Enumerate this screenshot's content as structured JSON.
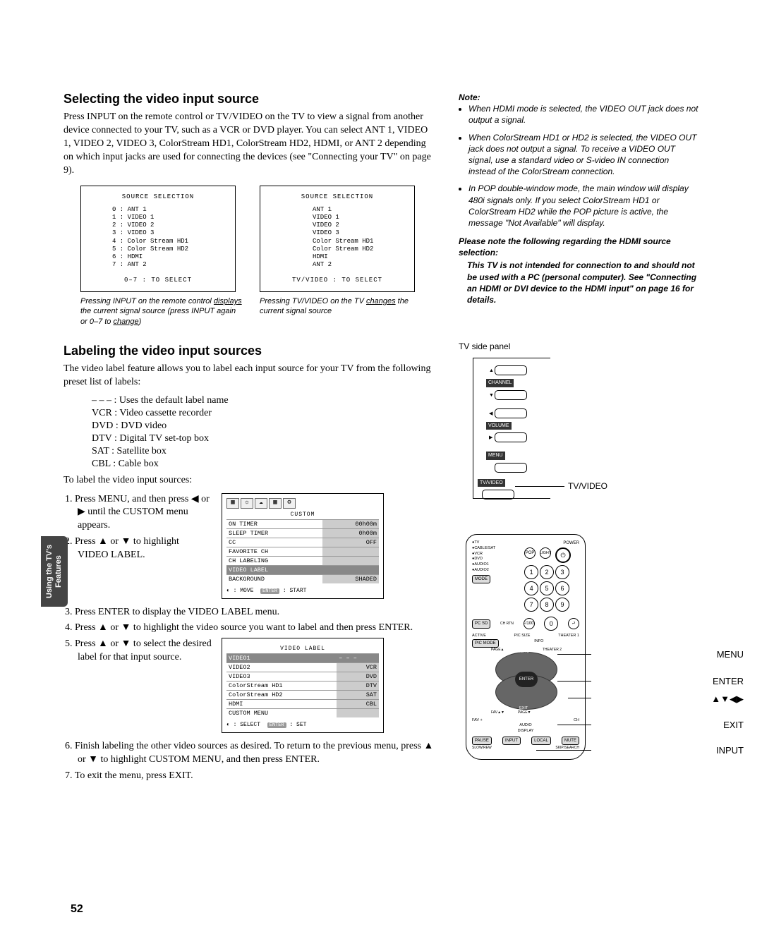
{
  "sidetab": "Using the TV's Features",
  "section1": {
    "heading": "Selecting the video input source",
    "body": "Press INPUT on the remote control or TV/VIDEO on the TV to view a signal from another device connected to your TV, such as a VCR or DVD player. You can select ANT 1, VIDEO 1, VIDEO 2, VIDEO 3, ColorStream HD1, ColorStream HD2, HDMI, or ANT 2 depending on which input jacks are used for connecting the devices (see \"Connecting your TV\" on page 9).",
    "osd1": {
      "title": "SOURCE SELECTION",
      "items": [
        "0 : ANT 1",
        "1 : VIDEO 1",
        "2 : VIDEO 2",
        "3 : VIDEO 3",
        "4 : Color Stream HD1",
        "5 : Color Stream HD2",
        "6 : HDMI",
        "7 : ANT 2"
      ],
      "footer": "0–7 : TO SELECT"
    },
    "osd2": {
      "title": "SOURCE SELECTION",
      "items": [
        "ANT 1",
        "VIDEO 1",
        "VIDEO 2",
        "VIDEO 3",
        "Color Stream HD1",
        "Color Stream HD2",
        "HDMI",
        "ANT 2"
      ],
      "footer": "TV/VIDEO : TO SELECT"
    },
    "caption1a": "Pressing INPUT on the remote control ",
    "caption1b": "displays",
    "caption1c": " the current signal source (press INPUT again or 0–7 to ",
    "caption1d": "change",
    "caption1e": ")",
    "caption2a": "Pressing TV/VIDEO on the TV ",
    "caption2b": "changes",
    "caption2c": " the current signal source"
  },
  "section2": {
    "heading": "Labeling the video input sources",
    "body": "The video label feature allows you to label each input source for your TV from the following preset list of labels:",
    "labels": [
      "– – –   : Uses the default label name",
      "VCR   : Video cassette recorder",
      "DVD  : DVD video",
      "DTV   : Digital TV set-top box",
      "SAT     : Satellite box",
      "CBL    : Cable box"
    ],
    "instr": "To label the video input sources:",
    "step1": "1.  Press MENU, and then press ◀ or ▶ until the CUSTOM menu appears.",
    "step2": "2.  Press ▲ or ▼ to highlight VIDEO LABEL.",
    "step3": "3.  Press ENTER to display the VIDEO LABEL menu.",
    "step4": "4.  Press ▲ or ▼ to highlight the video source you want to label and then press ENTER.",
    "step5": "5.  Press ▲ or ▼ to select the desired label for that input source.",
    "step6": "6.  Finish labeling the other video sources as desired. To return to the previous menu, press ▲ or ▼ to highlight CUSTOM MENU, and then press ENTER.",
    "step7": "7.  To exit the menu, press EXIT.",
    "menu1": {
      "tab": "CUSTOM",
      "rows": [
        {
          "l": "ON TIMER",
          "r": "00h00m"
        },
        {
          "l": "SLEEP TIMER",
          "r": "0h00m"
        },
        {
          "l": "CC",
          "r": "OFF"
        },
        {
          "l": "FAVORITE CH",
          "r": ""
        },
        {
          "l": "CH LABELING",
          "r": ""
        },
        {
          "l": "VIDEO LABEL",
          "r": "",
          "hl": true
        },
        {
          "l": "BACKGROUND",
          "r": "SHADED"
        }
      ],
      "foot_a": "◐ : MOVE",
      "foot_btn": "ENTER",
      "foot_b": ": START"
    },
    "menu2": {
      "tab": "VIDEO LABEL",
      "rows": [
        {
          "l": "VIDEO1",
          "r": "– – –",
          "hl": true
        },
        {
          "l": "VIDEO2",
          "r": "VCR"
        },
        {
          "l": "VIDEO3",
          "r": "DVD"
        },
        {
          "l": "ColorStream HD1",
          "r": "DTV"
        },
        {
          "l": "ColorStream HD2",
          "r": "SAT"
        },
        {
          "l": "HDMI",
          "r": "CBL"
        },
        {
          "l": "CUSTOM MENU",
          "r": ""
        }
      ],
      "foot_a": "◐ : SELECT",
      "foot_btn": "ENTER",
      "foot_b": ": SET"
    }
  },
  "notes": {
    "head": "Note:",
    "n1": "When HDMI mode is selected, the VIDEO OUT jack does not output a signal.",
    "n2": "When ColorStream HD1 or HD2 is selected, the VIDEO OUT jack does not output a signal. To receive a VIDEO OUT signal, use a standard video or S-video IN connection instead of the ColorStream connection.",
    "n3": "In POP double-window mode, the main window will display 480i signals only. If you select ColorStream HD1 or ColorStream HD2 while the POP picture is active, the message \"Not Available\" will display.",
    "head2": "Please note the following regarding the HDMI source selection:",
    "body2": "This TV is not intended for connection to and should not be used with a PC (personal computer). See \"Connecting an HDMI or DVI device to the HDMI input\" on page 16 for details."
  },
  "tvpanel": {
    "title": "TV side panel",
    "channel": "CHANNEL",
    "volume": "VOLUME",
    "menu": "MENU",
    "tvvideo": "TV/VIDEO",
    "callout": "TV/VIDEO"
  },
  "remote": {
    "tv": "●TV",
    "cablesat": "●CABLE/SAT",
    "vcr": "●VCR",
    "dvd": "●DVD",
    "aud1": "●AUDIO1",
    "aud2": "●AUDIO2",
    "mode": "MODE",
    "power": "POWER",
    "light": "LIGHT",
    "pop": "POP",
    "chrtn": "CH RTN",
    "pcsd": "PC SD",
    "active": "ACTIVE",
    "picmode": "PIC MODE",
    "picsize": "PIC SIZE",
    "info": "INFO",
    "theater1": "THEATER 1",
    "pagea": "PAGE▲",
    "menu": "MENU",
    "theater2": "THEATER 2",
    "exit": "EXIT",
    "pageb": "PAGE▼",
    "enter": "ENTER",
    "favab": "FAV▲▼",
    "fav": "FAV +",
    "ch": "CH",
    "audio": "AUDIO",
    "display": "DISPLAY",
    "pause": "PAUSE",
    "input": "INPUT",
    "local": "LOCAL",
    "mute": "MUTE",
    "skipsrch": "SKIP/SEARCH",
    "slowrev": "SLOW/REW",
    "labels": {
      "menu": "MENU",
      "enter": "ENTER",
      "cursor": "▲▼◀▶",
      "exit": "EXIT",
      "input": "INPUT"
    }
  },
  "page": "52"
}
